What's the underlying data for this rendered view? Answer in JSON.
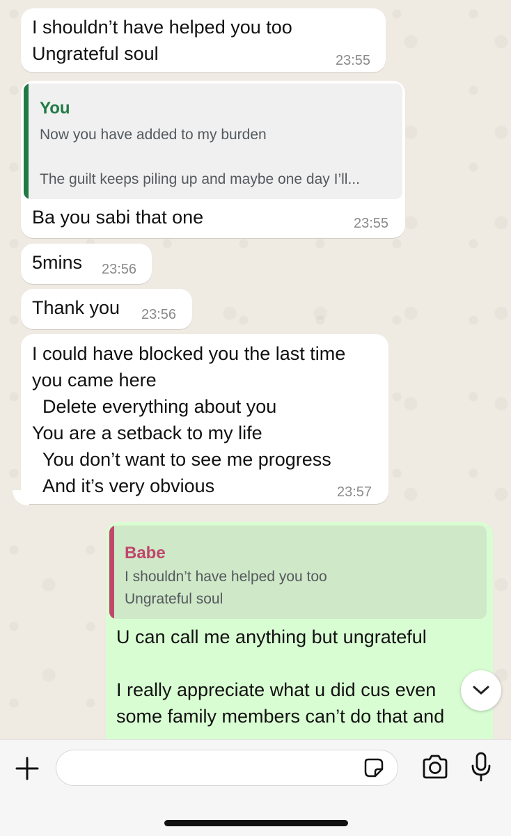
{
  "messages": [
    {
      "text": "I shouldn’t have helped you too\nUngrateful soul",
      "time": "23:55"
    },
    {
      "quote": {
        "sender": "You",
        "text": "Now you have added to my burden\n\nThe guilt keeps piling up and maybe one day I’ll..."
      },
      "text": "Ba you sabi that one",
      "time": "23:55"
    },
    {
      "text": "5mins",
      "time": "23:56"
    },
    {
      "text": "Thank you",
      "time": "23:56"
    },
    {
      "text": "I could have blocked you the last time\nyou came here\n  Delete everything about you\nYou are a setback to my life\n  You don’t want to see me progress\n  And it’s very obvious",
      "time": "23:57"
    },
    {
      "quote": {
        "sender": "Babe",
        "text": "I shouldn’t have helped you too\nUngrateful soul"
      },
      "text": "U can call me anything but ungrateful\n\nI really appreciate what u did cus even\nsome family members can’t do that and"
    }
  ],
  "composer": {
    "placeholder": ""
  },
  "icons": {
    "add": "plus-icon",
    "sticker": "sticker-icon",
    "camera": "camera-icon",
    "mic": "microphone-icon",
    "scroll": "chevron-down-icon"
  },
  "colors": {
    "incoming": "#ffffff",
    "outgoing": "#d9fdd3",
    "quote_you": "#1f7a44",
    "quote_babe": "#c0466b",
    "background": "#efeae2"
  }
}
